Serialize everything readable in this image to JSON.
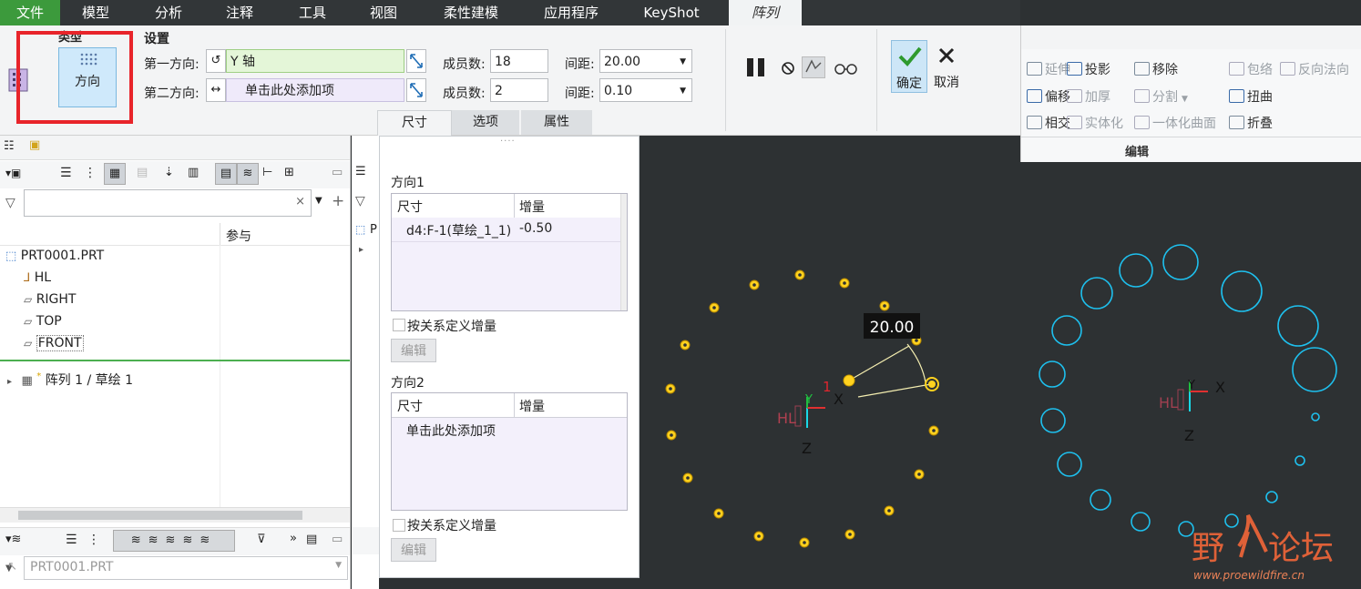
{
  "menu": {
    "file": "文件",
    "model": "模型",
    "analysis": "分析",
    "annotate": "注释",
    "tools": "工具",
    "view": "视图",
    "flex": "柔性建模",
    "apps": "应用程序",
    "keyshot": "KeyShot",
    "pattern": "阵列"
  },
  "ribbon": {
    "type_label": "类型",
    "type_button": "方向",
    "settings_label": "设置",
    "dir1_label": "第一方向:",
    "dir1_value": "Y 轴",
    "dir2_label": "第二方向:",
    "dir2_value": "单击此处添加项",
    "members_label": "成员数:",
    "members1": "18",
    "members2": "2",
    "spacing_label": "间距:",
    "spacing1": "20.00",
    "spacing2": "0.10",
    "ok": "确定",
    "cancel": "取消",
    "tabs": [
      "尺寸",
      "选项",
      "属性"
    ]
  },
  "edit_panel": {
    "items": [
      "延伸",
      "投影",
      "移除",
      "包络",
      "反向法向",
      "偏移",
      "加厚",
      "分割",
      "扭曲",
      "相交",
      "实体化",
      "一体化曲面",
      "折叠"
    ],
    "group_label": "编辑"
  },
  "tree": {
    "col_header": "参与",
    "root": "PRT0001.PRT",
    "items": [
      "HL",
      "RIGHT",
      "TOP",
      "FRONT"
    ],
    "feature": "阵列 1 / 草绘 1",
    "bottom_select": "PRT0001.PRT",
    "clip_letter": "P"
  },
  "dims": {
    "dir1_title": "方向1",
    "col_dim": "尺寸",
    "col_inc": "增量",
    "row_dim": "d4:F-1(草绘_1_1)",
    "row_inc": "-0.50",
    "relation_label": "按关系定义增量",
    "edit_label": "编辑",
    "dir2_title": "方向2",
    "dir2_placeholder": "单击此处添加项"
  },
  "viewport": {
    "dim_value": "20.00",
    "small_label": "1",
    "axis_x": "X",
    "axis_y": "Y",
    "axis_z": "Z",
    "axis_hl": "HL"
  },
  "watermark": {
    "cn_a": "野",
    "cn_b": "论坛",
    "url": "www.proewildfire.cn"
  },
  "colors": {
    "menubar": "#323638",
    "active_green": "#3c9a3c",
    "viewport": "#2d3133",
    "point_yellow": "#ffd21f",
    "circle_cyan": "#1ec0ee",
    "red_highlight": "#e8242a"
  }
}
